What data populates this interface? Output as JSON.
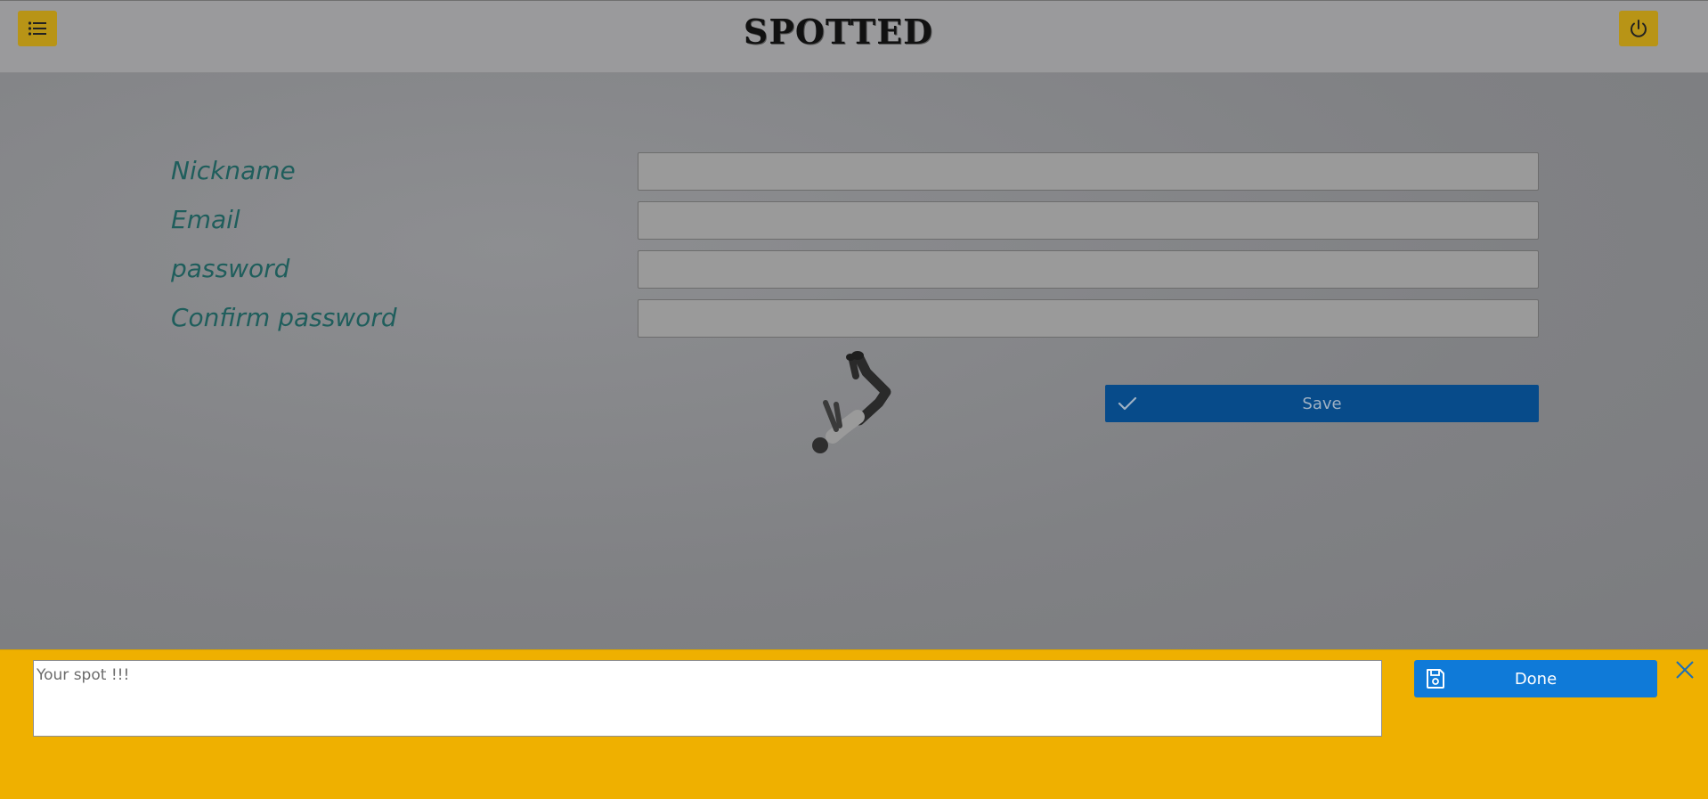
{
  "header": {
    "brand": "SPOTTED",
    "menu_icon": "list-icon",
    "power_icon": "power-icon"
  },
  "form": {
    "fields": [
      {
        "label": "Nickname",
        "value": ""
      },
      {
        "label": "Email",
        "value": ""
      },
      {
        "label": "password",
        "value": ""
      },
      {
        "label": "Confirm password",
        "value": ""
      }
    ],
    "save_label": "Save",
    "save_icon": "checkmark-icon"
  },
  "bottom_bar": {
    "spot_placeholder": "Your spot !!!",
    "done_label": "Done",
    "done_icon": "floppy-disk-icon",
    "close_icon": "close-icon"
  },
  "colors": {
    "accent_yellow": "#efb000",
    "done_blue": "#0f7ad8",
    "save_blue": "#074b8a",
    "label_teal": "#1f5e5c"
  }
}
